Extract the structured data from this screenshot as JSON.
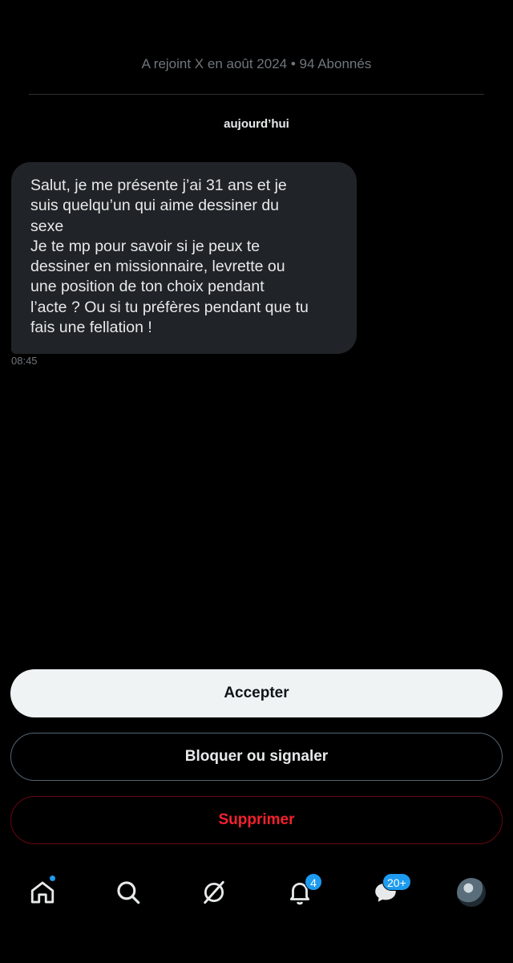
{
  "profile": {
    "meta": "A rejoint X en août 2024 • 94 Abonnés"
  },
  "conversation": {
    "date_label": "aujourd’hui",
    "message": {
      "text": "Salut, je me présente j’ai 31 ans et je\nsuis quelqu’un qui aime dessiner du\nsexe\nJe te mp pour savoir si je peux te\ndessiner en missionnaire, levrette ou\nune position de ton choix pendant\nl’acte ? Ou si tu préfères pendant que tu\nfais une fellation !",
      "time": "08:45"
    }
  },
  "actions": {
    "accept": "Accepter",
    "block": "Bloquer ou signaler",
    "delete": "Supprimer"
  },
  "tabbar": {
    "home": {
      "icon": "home-icon",
      "has_dot": true
    },
    "search": {
      "icon": "search-icon"
    },
    "grok": {
      "icon": "grok-icon"
    },
    "notifications": {
      "icon": "bell-icon",
      "badge": "4"
    },
    "messages": {
      "icon": "messages-icon",
      "badge": "20+"
    },
    "profile": {
      "icon": "avatar"
    }
  },
  "colors": {
    "background": "#000000",
    "bubble": "#202327",
    "accent": "#1d9bf0",
    "danger": "#f4212e",
    "muted": "#71767b"
  }
}
